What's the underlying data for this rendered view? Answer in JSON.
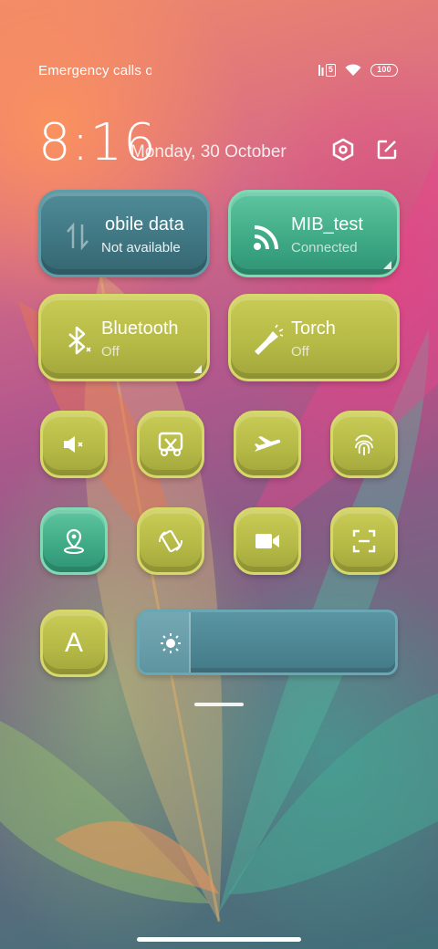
{
  "status_bar": {
    "carrier_text": "Emergency calls o",
    "sim_label": "5",
    "battery_level": "100"
  },
  "header": {
    "time": "8:16",
    "date": "Monday, 30 October",
    "settings_icon": "settings-hexagon-icon",
    "edit_icon": "edit-icon"
  },
  "tiles": {
    "mobile_data": {
      "title": "obile data",
      "subtitle": "Not available",
      "icon": "mobile-data-icon",
      "active": false
    },
    "wifi": {
      "title": "MIB_test",
      "subtitle": "Connected",
      "icon": "wifi-icon",
      "active": true
    },
    "bluetooth": {
      "title": "Bluetooth",
      "subtitle": "Off",
      "icon": "bluetooth-icon",
      "active": false
    },
    "torch": {
      "title": "Torch",
      "subtitle": "Off",
      "icon": "flashlight-icon",
      "active": false
    }
  },
  "small_tiles": [
    {
      "name": "mute",
      "icon": "mute-icon"
    },
    {
      "name": "screenshot",
      "icon": "scissors-screenshot-icon"
    },
    {
      "name": "airplane-mode",
      "icon": "airplane-icon"
    },
    {
      "name": "fingerprint",
      "icon": "fingerprint-icon"
    },
    {
      "name": "location",
      "icon": "location-icon",
      "active": true
    },
    {
      "name": "auto-rotate",
      "icon": "rotate-icon"
    },
    {
      "name": "screen-record",
      "icon": "video-camera-icon"
    },
    {
      "name": "scanner",
      "icon": "scan-icon"
    }
  ],
  "auto_brightness": {
    "label": "A"
  },
  "brightness": {
    "level": 0.2,
    "icon": "brightness-icon"
  },
  "colors": {
    "olive": "#b4b845",
    "teal": "#3da884",
    "steel": "#3e7581"
  }
}
